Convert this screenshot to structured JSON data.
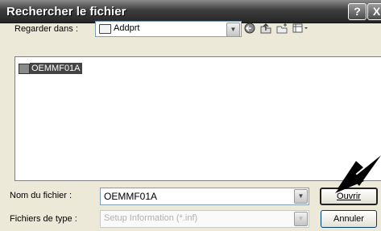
{
  "window": {
    "title": "Rechercher le fichier",
    "help_button": "?",
    "close_button": "X"
  },
  "look_in": {
    "label": "Regarder dans :",
    "value": "Addprt",
    "dropdown_arrow": "▼"
  },
  "toolbar": {
    "back_icon": "back-icon",
    "up_icon": "up-folder-icon",
    "new_folder_icon": "new-folder-icon",
    "view_menu_icon": "view-menu-icon"
  },
  "files": [
    {
      "name": "OEMMF01A",
      "selected": true
    }
  ],
  "file_name": {
    "label": "Nom du fichier :",
    "value": "OEMMF01A",
    "dropdown_arrow": "▼"
  },
  "file_type": {
    "label": "Fichiers de type :",
    "value": "Setup Information (*.inf)",
    "dropdown_arrow": "▼"
  },
  "buttons": {
    "open": "Ouvrir",
    "cancel": "Annuler"
  }
}
